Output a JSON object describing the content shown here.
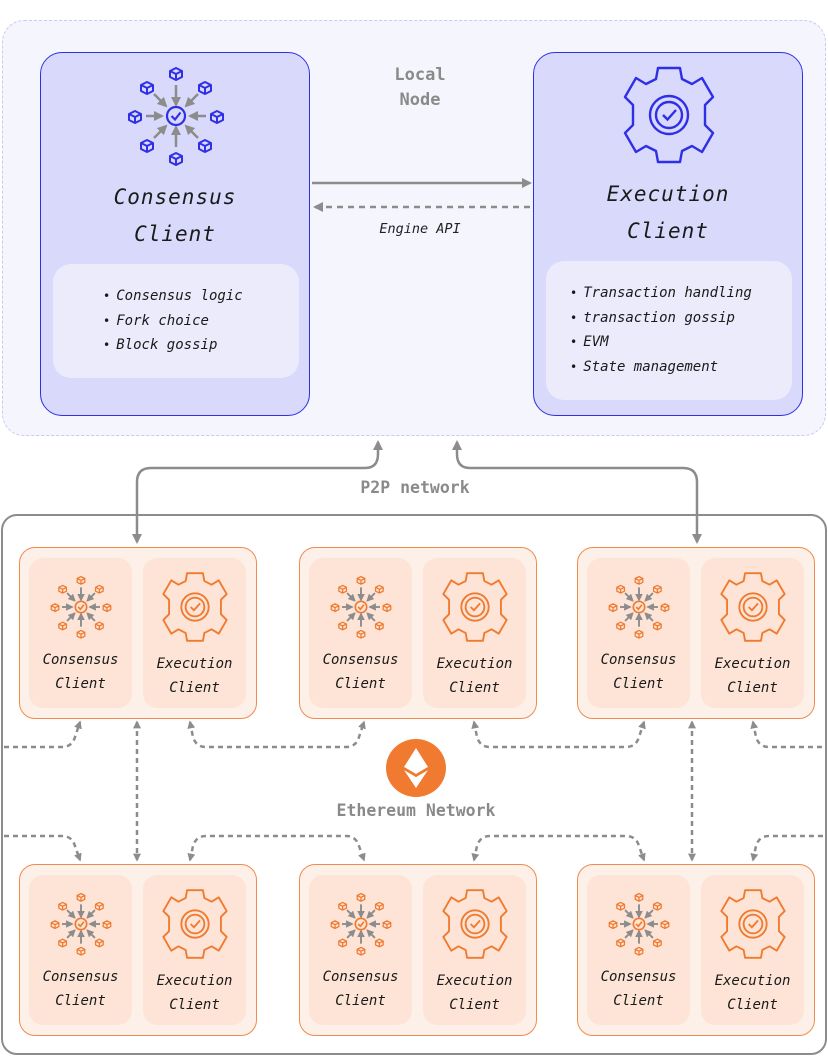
{
  "local_node": {
    "label_line1": "Local",
    "label_line2": "Node",
    "engine_api_label": "Engine API",
    "consensus_client": {
      "title_line1": "Consensus",
      "title_line2": "Client",
      "features": [
        "Consensus logic",
        "Fork choice",
        "Block gossip"
      ]
    },
    "execution_client": {
      "title_line1": "Execution",
      "title_line2": "Client",
      "features": [
        "Transaction handling",
        "transaction gossip",
        "EVM",
        "State management"
      ]
    }
  },
  "p2p_label": "P2P network",
  "ethereum_network": {
    "label": "Ethereum Network",
    "nodes": [
      {
        "consensus_line1": "Consensus",
        "consensus_line2": "Client",
        "execution_line1": "Execution",
        "execution_line2": "Client"
      },
      {
        "consensus_line1": "Consensus",
        "consensus_line2": "Client",
        "execution_line1": "Execution",
        "execution_line2": "Client"
      },
      {
        "consensus_line1": "Consensus",
        "consensus_line2": "Client",
        "execution_line1": "Execution",
        "execution_line2": "Client"
      },
      {
        "consensus_line1": "Consensus",
        "consensus_line2": "Client",
        "execution_line1": "Execution",
        "execution_line2": "Client"
      },
      {
        "consensus_line1": "Consensus",
        "consensus_line2": "Client",
        "execution_line1": "Execution",
        "execution_line2": "Client"
      },
      {
        "consensus_line1": "Consensus",
        "consensus_line2": "Client",
        "execution_line1": "Execution",
        "execution_line2": "Client"
      }
    ]
  },
  "colors": {
    "local_accent": "#2f2fe6",
    "network_accent": "#f07a2f",
    "arrow_gray": "#8c8c8c"
  }
}
